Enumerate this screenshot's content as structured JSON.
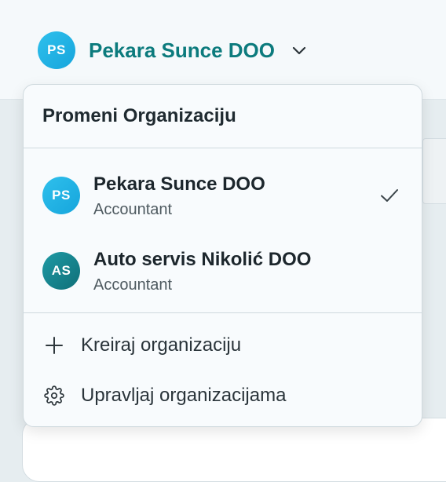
{
  "header": {
    "current_org": {
      "initials": "PS",
      "name": "Pekara Sunce DOO"
    }
  },
  "dropdown": {
    "title": "Promeni Organizaciju",
    "organizations": [
      {
        "initials": "PS",
        "name": "Pekara Sunce DOO",
        "role": "Accountant",
        "selected": true
      },
      {
        "initials": "AS",
        "name": "Auto servis Nikolić DOO",
        "role": "Accountant",
        "selected": false
      }
    ],
    "actions": [
      {
        "icon": "plus-icon",
        "label": "Kreiraj organizaciju"
      },
      {
        "icon": "gear-icon",
        "label": "Upravljaj organizacijama"
      }
    ]
  },
  "colors": {
    "brand_teal": "#0c7b7d",
    "avatar_ps": "#1fb3e6",
    "avatar_as": "#157f89"
  }
}
